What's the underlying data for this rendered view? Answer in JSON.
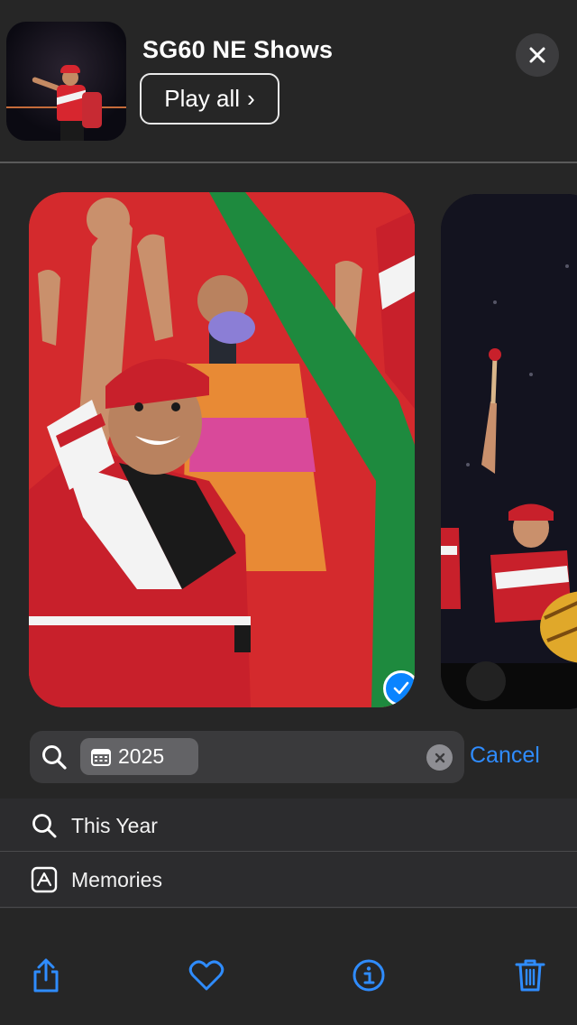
{
  "header": {
    "album_title": "SG60 NE Shows",
    "play_all_label": "Play all",
    "play_all_chevron": "›",
    "close_icon": "close-icon"
  },
  "photos": {
    "main_selected": true,
    "selected_icon": "checkmark-circle-icon"
  },
  "search": {
    "search_icon": "magnifying-glass-icon",
    "token_icon": "calendar-icon",
    "token_label": "2025",
    "clear_icon": "clear-x-icon",
    "cancel_label": "Cancel"
  },
  "suggestions": [
    {
      "icon": "magnifying-glass-icon",
      "label": "This Year"
    },
    {
      "icon": "memories-icon",
      "label": "Memories"
    }
  ],
  "toolbar": {
    "share_icon": "share-icon",
    "favorite_icon": "heart-icon",
    "info_icon": "info-icon",
    "delete_icon": "trash-icon"
  },
  "colors": {
    "accent": "#2f8cff",
    "background": "#262626",
    "field": "#3a3a3c",
    "token": "#636366",
    "selection_badge": "#0a84ff"
  }
}
